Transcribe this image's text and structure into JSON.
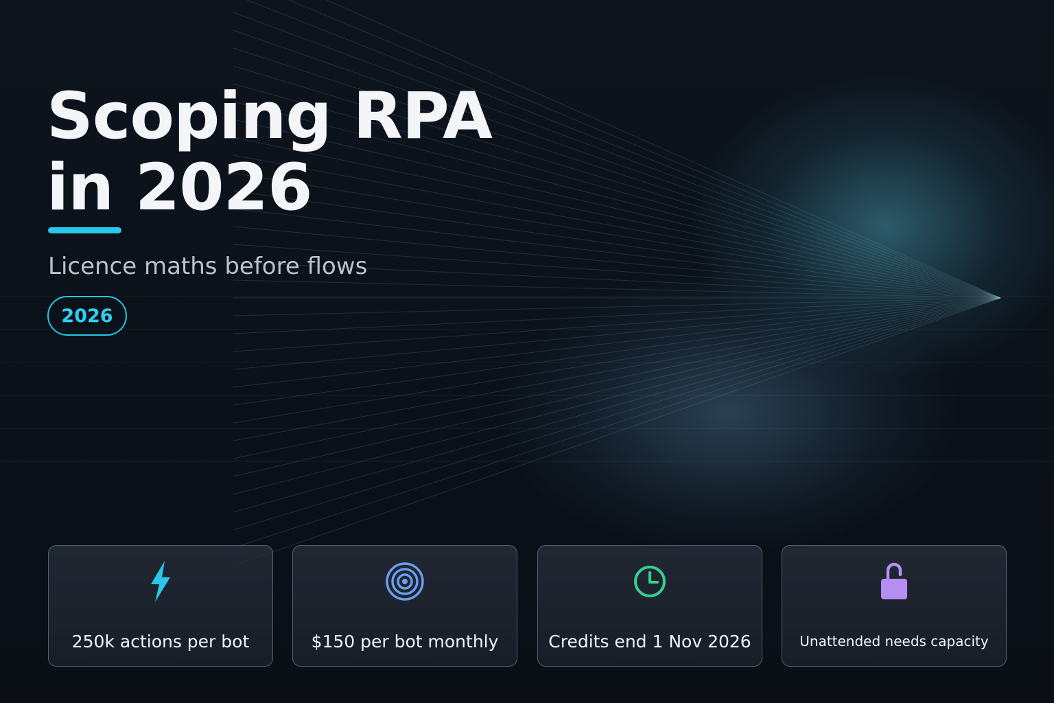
{
  "hero": {
    "title_line1": "Scoping RPA",
    "title_line2_highlight": "in",
    "title_line2_rest": " 2026",
    "subtitle": "Licence maths before flows",
    "year_pill": "2026"
  },
  "cards": [
    {
      "label": "250k actions per bot",
      "icon": "lightning-bolt-icon",
      "color": "#2bc6ea"
    },
    {
      "label": "$150 per bot monthly",
      "icon": "target-icon",
      "color": "#6b9cf0"
    },
    {
      "label": "Credits end 1 Nov 2026",
      "icon": "clock-icon",
      "color": "#34d08c"
    },
    {
      "label": "Unattended needs capacity",
      "icon": "lock-icon",
      "color": "#b68ef2"
    }
  ],
  "colors": {
    "accent": "#28c8ea",
    "background": "#0b111a"
  }
}
